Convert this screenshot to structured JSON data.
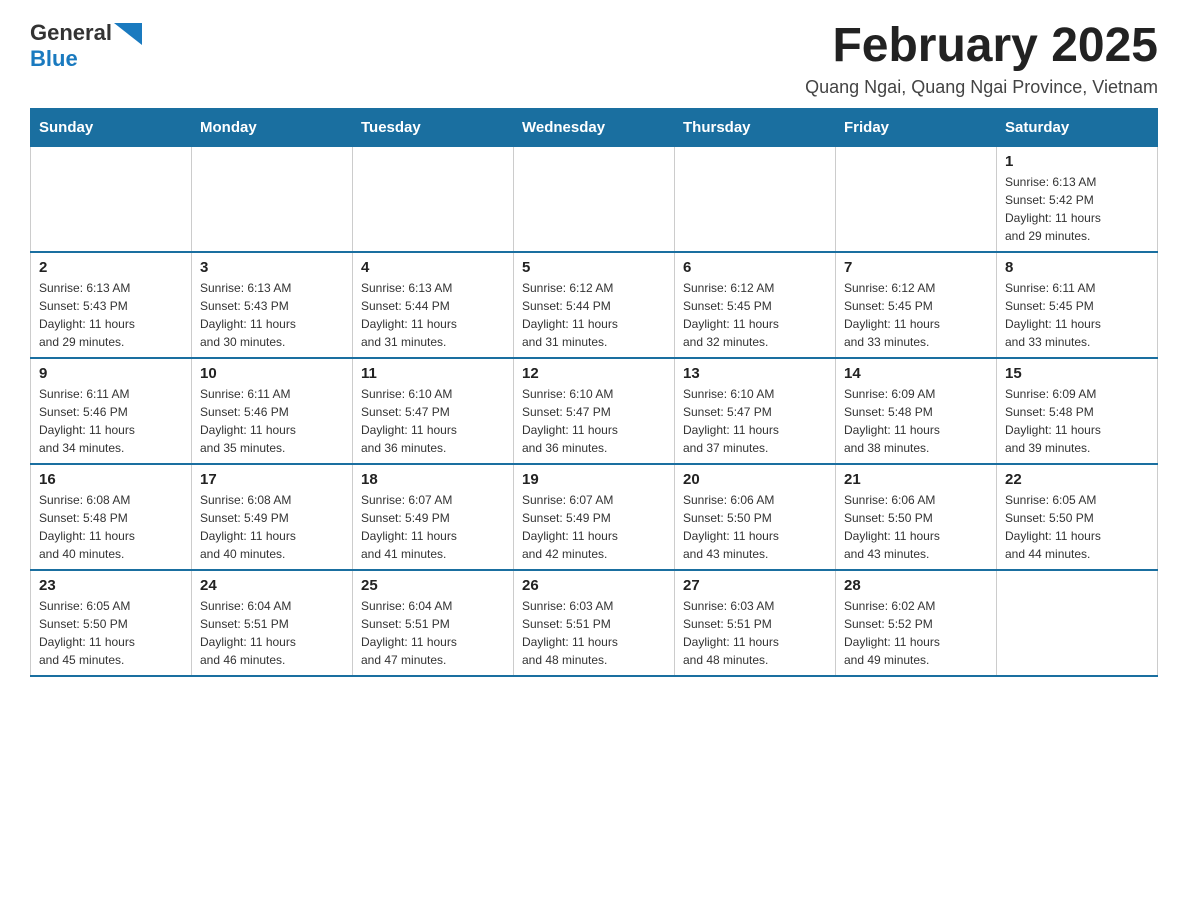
{
  "header": {
    "logo_general": "General",
    "logo_blue": "Blue",
    "month_title": "February 2025",
    "location": "Quang Ngai, Quang Ngai Province, Vietnam"
  },
  "weekdays": [
    "Sunday",
    "Monday",
    "Tuesday",
    "Wednesday",
    "Thursday",
    "Friday",
    "Saturday"
  ],
  "rows": [
    [
      {
        "day": "",
        "info": ""
      },
      {
        "day": "",
        "info": ""
      },
      {
        "day": "",
        "info": ""
      },
      {
        "day": "",
        "info": ""
      },
      {
        "day": "",
        "info": ""
      },
      {
        "day": "",
        "info": ""
      },
      {
        "day": "1",
        "info": "Sunrise: 6:13 AM\nSunset: 5:42 PM\nDaylight: 11 hours\nand 29 minutes."
      }
    ],
    [
      {
        "day": "2",
        "info": "Sunrise: 6:13 AM\nSunset: 5:43 PM\nDaylight: 11 hours\nand 29 minutes."
      },
      {
        "day": "3",
        "info": "Sunrise: 6:13 AM\nSunset: 5:43 PM\nDaylight: 11 hours\nand 30 minutes."
      },
      {
        "day": "4",
        "info": "Sunrise: 6:13 AM\nSunset: 5:44 PM\nDaylight: 11 hours\nand 31 minutes."
      },
      {
        "day": "5",
        "info": "Sunrise: 6:12 AM\nSunset: 5:44 PM\nDaylight: 11 hours\nand 31 minutes."
      },
      {
        "day": "6",
        "info": "Sunrise: 6:12 AM\nSunset: 5:45 PM\nDaylight: 11 hours\nand 32 minutes."
      },
      {
        "day": "7",
        "info": "Sunrise: 6:12 AM\nSunset: 5:45 PM\nDaylight: 11 hours\nand 33 minutes."
      },
      {
        "day": "8",
        "info": "Sunrise: 6:11 AM\nSunset: 5:45 PM\nDaylight: 11 hours\nand 33 minutes."
      }
    ],
    [
      {
        "day": "9",
        "info": "Sunrise: 6:11 AM\nSunset: 5:46 PM\nDaylight: 11 hours\nand 34 minutes."
      },
      {
        "day": "10",
        "info": "Sunrise: 6:11 AM\nSunset: 5:46 PM\nDaylight: 11 hours\nand 35 minutes."
      },
      {
        "day": "11",
        "info": "Sunrise: 6:10 AM\nSunset: 5:47 PM\nDaylight: 11 hours\nand 36 minutes."
      },
      {
        "day": "12",
        "info": "Sunrise: 6:10 AM\nSunset: 5:47 PM\nDaylight: 11 hours\nand 36 minutes."
      },
      {
        "day": "13",
        "info": "Sunrise: 6:10 AM\nSunset: 5:47 PM\nDaylight: 11 hours\nand 37 minutes."
      },
      {
        "day": "14",
        "info": "Sunrise: 6:09 AM\nSunset: 5:48 PM\nDaylight: 11 hours\nand 38 minutes."
      },
      {
        "day": "15",
        "info": "Sunrise: 6:09 AM\nSunset: 5:48 PM\nDaylight: 11 hours\nand 39 minutes."
      }
    ],
    [
      {
        "day": "16",
        "info": "Sunrise: 6:08 AM\nSunset: 5:48 PM\nDaylight: 11 hours\nand 40 minutes."
      },
      {
        "day": "17",
        "info": "Sunrise: 6:08 AM\nSunset: 5:49 PM\nDaylight: 11 hours\nand 40 minutes."
      },
      {
        "day": "18",
        "info": "Sunrise: 6:07 AM\nSunset: 5:49 PM\nDaylight: 11 hours\nand 41 minutes."
      },
      {
        "day": "19",
        "info": "Sunrise: 6:07 AM\nSunset: 5:49 PM\nDaylight: 11 hours\nand 42 minutes."
      },
      {
        "day": "20",
        "info": "Sunrise: 6:06 AM\nSunset: 5:50 PM\nDaylight: 11 hours\nand 43 minutes."
      },
      {
        "day": "21",
        "info": "Sunrise: 6:06 AM\nSunset: 5:50 PM\nDaylight: 11 hours\nand 43 minutes."
      },
      {
        "day": "22",
        "info": "Sunrise: 6:05 AM\nSunset: 5:50 PM\nDaylight: 11 hours\nand 44 minutes."
      }
    ],
    [
      {
        "day": "23",
        "info": "Sunrise: 6:05 AM\nSunset: 5:50 PM\nDaylight: 11 hours\nand 45 minutes."
      },
      {
        "day": "24",
        "info": "Sunrise: 6:04 AM\nSunset: 5:51 PM\nDaylight: 11 hours\nand 46 minutes."
      },
      {
        "day": "25",
        "info": "Sunrise: 6:04 AM\nSunset: 5:51 PM\nDaylight: 11 hours\nand 47 minutes."
      },
      {
        "day": "26",
        "info": "Sunrise: 6:03 AM\nSunset: 5:51 PM\nDaylight: 11 hours\nand 48 minutes."
      },
      {
        "day": "27",
        "info": "Sunrise: 6:03 AM\nSunset: 5:51 PM\nDaylight: 11 hours\nand 48 minutes."
      },
      {
        "day": "28",
        "info": "Sunrise: 6:02 AM\nSunset: 5:52 PM\nDaylight: 11 hours\nand 49 minutes."
      },
      {
        "day": "",
        "info": ""
      }
    ]
  ]
}
